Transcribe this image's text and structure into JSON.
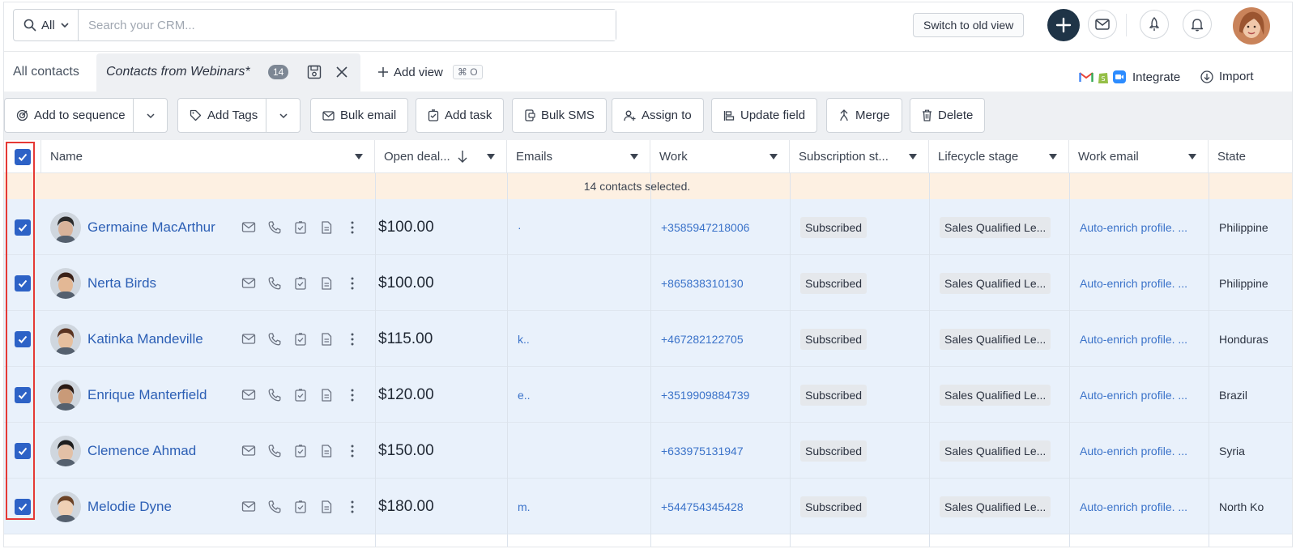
{
  "topbar": {
    "scope_label": "All",
    "search_placeholder": "Search your CRM...",
    "switch_view_label": "Switch to old view"
  },
  "viewbar": {
    "all_contacts": "All contacts",
    "active_view": "Contacts from Webinars*",
    "active_view_count": "14",
    "add_view": "Add view",
    "add_view_shortcut": "⌘ O",
    "integrate": "Integrate",
    "import": "Import"
  },
  "actions": {
    "add_to_sequence": "Add to sequence",
    "add_tags": "Add Tags",
    "bulk_email": "Bulk email",
    "add_task": "Add task",
    "bulk_sms": "Bulk SMS",
    "assign_to": "Assign to",
    "update_field": "Update field",
    "merge": "Merge",
    "delete": "Delete"
  },
  "table": {
    "columns": [
      "Name",
      "Open deal...",
      "Emails",
      "Work",
      "Subscription st...",
      "Lifecycle stage",
      "Work email",
      "State"
    ],
    "selection_banner": "14 contacts selected.",
    "rows": [
      {
        "name": "Germaine MacArthur",
        "deal": "$100.00",
        "email": "·",
        "work": "+3585947218006",
        "subscription": "Subscribed",
        "lifecycle": "Sales Qualified Le...",
        "work_email": "Auto-enrich profile. ...",
        "state": "Philippine"
      },
      {
        "name": "Nerta Birds",
        "deal": "$100.00",
        "email": "",
        "work": "+865838310130",
        "subscription": "Subscribed",
        "lifecycle": "Sales Qualified Le...",
        "work_email": "Auto-enrich profile. ...",
        "state": "Philippine"
      },
      {
        "name": "Katinka Mandeville",
        "deal": "$115.00",
        "email": "k..",
        "work": "+467282122705",
        "subscription": "Subscribed",
        "lifecycle": "Sales Qualified Le...",
        "work_email": "Auto-enrich profile. ...",
        "state": "Honduras"
      },
      {
        "name": "Enrique Manterfield",
        "deal": "$120.00",
        "email": "e..",
        "work": "+3519909884739",
        "subscription": "Subscribed",
        "lifecycle": "Sales Qualified Le...",
        "work_email": "Auto-enrich profile. ...",
        "state": "Brazil"
      },
      {
        "name": "Clemence Ahmad",
        "deal": "$150.00",
        "email": "",
        "work": "+633975131947",
        "subscription": "Subscribed",
        "lifecycle": "Sales Qualified Le...",
        "work_email": "Auto-enrich profile. ...",
        "state": "Syria"
      },
      {
        "name": "Melodie Dyne",
        "deal": "$180.00",
        "email": "m.",
        "work": "+544754345428",
        "subscription": "Subscribed",
        "lifecycle": "Sales Qualified Le...",
        "work_email": "Auto-enrich profile. ...",
        "state": "North Ko"
      }
    ]
  },
  "colors": {
    "primary_dark": "#1f3447",
    "link_blue": "#2c5fb5",
    "checkbox_blue": "#2d62c6",
    "row_selected_bg": "#e9f1fb",
    "banner_bg": "#fdf0e2",
    "highlight_red": "#e53935"
  }
}
